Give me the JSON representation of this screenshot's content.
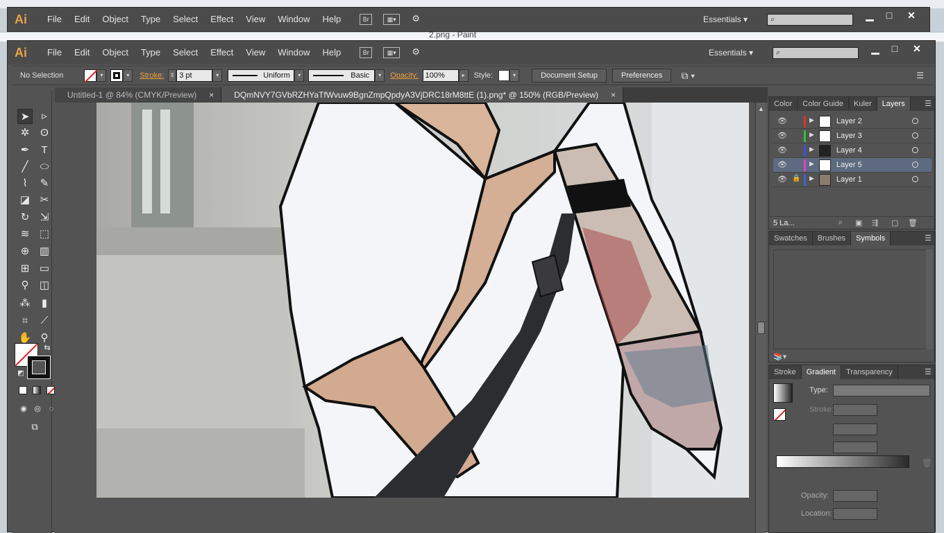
{
  "background": {
    "paint_title_fragment": "2.png - Paint"
  },
  "app": {
    "logo": "Ai",
    "menus": [
      "File",
      "Edit",
      "Object",
      "Type",
      "Select",
      "Effect",
      "View",
      "Window",
      "Help"
    ],
    "bridge_label": "Br",
    "workspace": "Essentials",
    "search_placeholder": "",
    "window_controls": {
      "minimize": "▬",
      "maximize": "□",
      "close": "✕"
    }
  },
  "control_bar": {
    "selection": "No Selection",
    "stroke_label": "Stroke:",
    "stroke_weight": "3 pt",
    "profile_uniform": "Uniform",
    "brush_basic": "Basic",
    "opacity_label": "Opacity:",
    "opacity_value": "100%",
    "style_label": "Style:",
    "document_setup": "Document Setup",
    "preferences": "Preferences"
  },
  "tabs": [
    {
      "label": "Untitled-1 @ 84% (CMYK/Preview)",
      "close": "×"
    },
    {
      "label": "DQmNVY7GVbRZHYaTfWvuw9BgnZmpQpdyA3VjDRC18rM8ttE (1).png* @ 150% (RGB/Preview)",
      "close": "×"
    }
  ],
  "layers_panel": {
    "tabs": [
      "Color",
      "Color Guide",
      "Kuler",
      "Layers"
    ],
    "active_tab": "Layers",
    "layers": [
      {
        "name": "Layer 2",
        "color": "#e03030",
        "locked": false,
        "selected": false
      },
      {
        "name": "Layer 3",
        "color": "#30c040",
        "locked": false,
        "selected": false
      },
      {
        "name": "Layer 4",
        "color": "#4050e0",
        "locked": false,
        "selected": false
      },
      {
        "name": "Layer 5",
        "color": "#e040d0",
        "locked": false,
        "selected": true
      },
      {
        "name": "Layer 1",
        "color": "#4060d0",
        "locked": true,
        "selected": false
      }
    ],
    "footer_count": "5 La..."
  },
  "symbols_panel": {
    "tabs": [
      "Swatches",
      "Brushes",
      "Symbols"
    ],
    "active_tab": "Symbols"
  },
  "gradient_panel": {
    "tabs": [
      "Stroke",
      "Gradient",
      "Transparency"
    ],
    "active_tab": "Gradient",
    "type_label": "Type:",
    "stroke_label": "Stroke:",
    "opacity_label": "Opacity:",
    "location_label": "Location:"
  }
}
